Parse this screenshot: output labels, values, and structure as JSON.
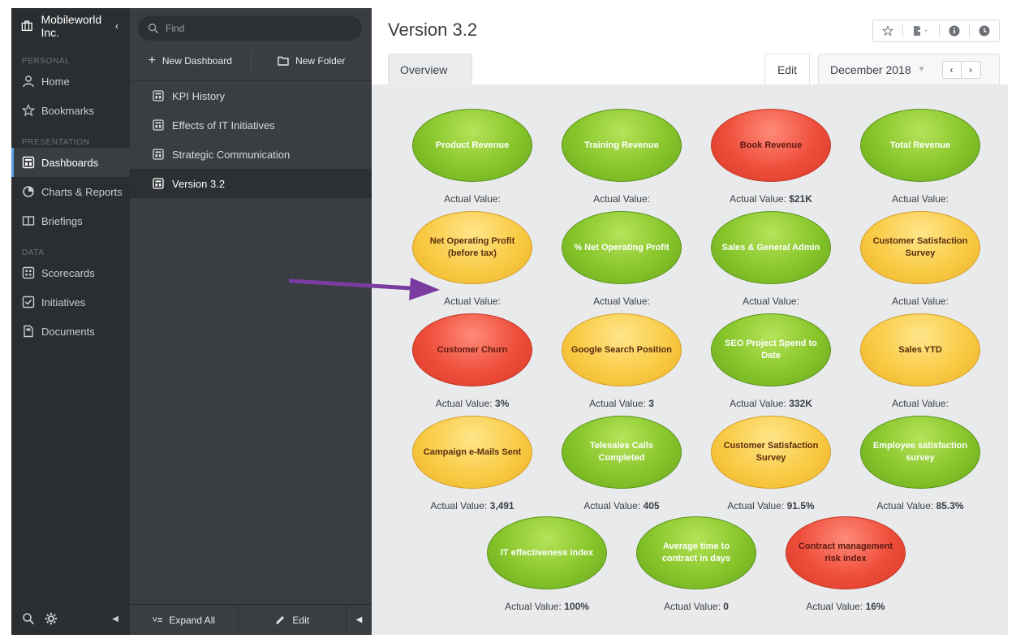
{
  "org": {
    "name": "Mobileworld Inc."
  },
  "nav": {
    "sections": [
      {
        "label": "PERSONAL",
        "items": [
          {
            "label": "Home",
            "icon": "person-icon"
          },
          {
            "label": "Bookmarks",
            "icon": "star-icon"
          }
        ]
      },
      {
        "label": "PRESENTATION",
        "items": [
          {
            "label": "Dashboards",
            "icon": "dashboard-icon",
            "active": true
          },
          {
            "label": "Charts & Reports",
            "icon": "pie-chart-icon"
          },
          {
            "label": "Briefings",
            "icon": "book-icon"
          }
        ]
      },
      {
        "label": "DATA",
        "items": [
          {
            "label": "Scorecards",
            "icon": "scorecard-icon"
          },
          {
            "label": "Initiatives",
            "icon": "checkbox-icon"
          },
          {
            "label": "Documents",
            "icon": "document-icon"
          }
        ]
      }
    ]
  },
  "list": {
    "search_placeholder": "Find",
    "new_dashboard": "New Dashboard",
    "new_folder": "New Folder",
    "rows": [
      "KPI History",
      "Effects of IT Initiatives",
      "Strategic Communication",
      "Version 3.2"
    ],
    "active_row": 3,
    "expand_all": "Expand All",
    "edit": "Edit"
  },
  "main": {
    "title": "Version 3.2",
    "tab_overview": "Overview",
    "tab_edit": "Edit",
    "month": "December 2018",
    "value_label": "Actual Value:"
  },
  "kpis": [
    {
      "name": "Product Revenue",
      "status": "green",
      "value": ""
    },
    {
      "name": "Training Revenue",
      "status": "green",
      "value": ""
    },
    {
      "name": "Book Revenue",
      "status": "red",
      "value": "$21K"
    },
    {
      "name": "Total Revenue",
      "status": "green",
      "value": ""
    },
    {
      "name": "Net Operating Profit (before tax)",
      "status": "yellow",
      "value": ""
    },
    {
      "name": "% Net Operating Profit",
      "status": "green",
      "value": ""
    },
    {
      "name": "Sales & General Admin",
      "status": "green",
      "value": ""
    },
    {
      "name": "Customer Satisfaction Survey",
      "status": "yellow",
      "value": ""
    },
    {
      "name": "Customer Churn",
      "status": "red",
      "value": "3%"
    },
    {
      "name": "Google Search Position",
      "status": "yellow",
      "value": "3"
    },
    {
      "name": "SEO Project Spend to Date",
      "status": "green",
      "value": "332K"
    },
    {
      "name": "Sales YTD",
      "status": "yellow",
      "value": ""
    },
    {
      "name": "Campaign e-Mails Sent",
      "status": "yellow",
      "value": "3,491"
    },
    {
      "name": "Telesales Calls Completed",
      "status": "green",
      "value": "405"
    },
    {
      "name": "Customer Satisfaction Survey",
      "status": "yellow",
      "value": "91.5%"
    },
    {
      "name": "Employee satisfaction survey",
      "status": "green",
      "value": "85.3%"
    },
    {
      "name": "IT effectiveness index",
      "status": "green",
      "value": "100%"
    },
    {
      "name": "Average time to contract in days",
      "status": "green",
      "value": "0"
    },
    {
      "name": "Contract management risk index",
      "status": "red",
      "value": "16%"
    }
  ],
  "colors": {
    "green": "#86c52a",
    "yellow": "#f9cb45",
    "red": "#ee4d3a",
    "arrow": "#7a3ca0",
    "accent": "#5aa0e6"
  }
}
